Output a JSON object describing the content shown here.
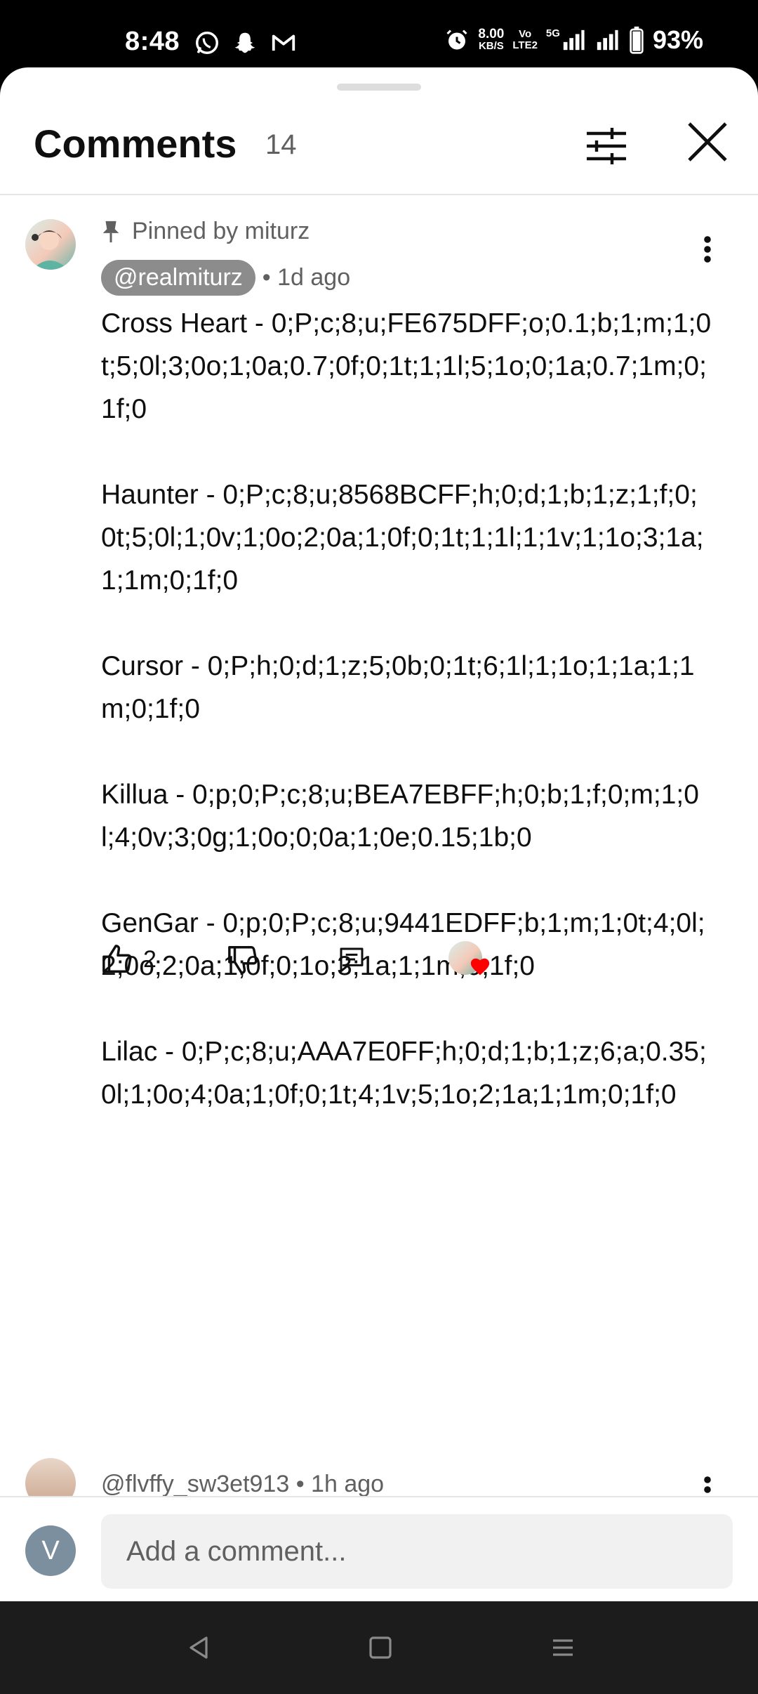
{
  "status_bar": {
    "time": "8:48",
    "net_speed_value": "8.00",
    "net_speed_unit": "KB/S",
    "volte_top": "Vo",
    "volte_bottom": "LTE2",
    "network": "5G",
    "battery": "93%",
    "left_icons": [
      "whatsapp-icon",
      "snapchat-icon",
      "gmail-icon"
    ],
    "right_icons": [
      "alarm-icon",
      "signal-icon",
      "signal-icon",
      "battery-icon"
    ]
  },
  "header": {
    "title": "Comments",
    "count": "14"
  },
  "pinned_comment": {
    "pinned_label": "Pinned by miturz",
    "author": "@realmiturz",
    "time": "• 1d ago",
    "text": "Cross Heart - 0;P;c;8;u;FE675DFF;o;0.1;b;1;m;1;0t;5;0l;3;0o;1;0a;0.7;0f;0;1t;1;1l;5;1o;0;1a;0.7;1m;0;1f;0\n\nHaunter - 0;P;c;8;u;8568BCFF;h;0;d;1;b;1;z;1;f;0;0t;5;0l;1;0v;1;0o;2;0a;1;0f;0;1t;1;1l;1;1v;1;1o;3;1a;1;1m;0;1f;0\n\nCursor - 0;P;h;0;d;1;z;5;0b;0;1t;6;1l;1;1o;1;1a;1;1m;0;1f;0\n\nKillua - 0;p;0;P;c;8;u;BEA7EBFF;h;0;b;1;f;0;m;1;0l;4;0v;3;0g;1;0o;0;0a;1;0e;0.15;1b;0\n\nGenGar - 0;p;0;P;c;8;u;9441EDFF;b;1;m;1;0t;4;0l;2;0o;2;0a;1;0f;0;1o;3;1a;1;1m;0;1f;0\n\nLilac - 0;P;c;8;u;AAA7E0FF;h;0;d;1;b;1;z;6;a;0.35;0l;1;0o;4;0a;1;0f;0;1t;4;1v;5;1o;2;1a;1;1m;0;1f;0",
    "likes": "2"
  },
  "second_comment": {
    "author": "@flvffy_sw3et913",
    "time": "• 1h ago"
  },
  "composer": {
    "avatar_letter": "V",
    "placeholder": "Add a comment..."
  },
  "colors": {
    "heart": "#ff0000",
    "avatar_v": "#7b8f9e",
    "chip": "#8c8c8c"
  }
}
